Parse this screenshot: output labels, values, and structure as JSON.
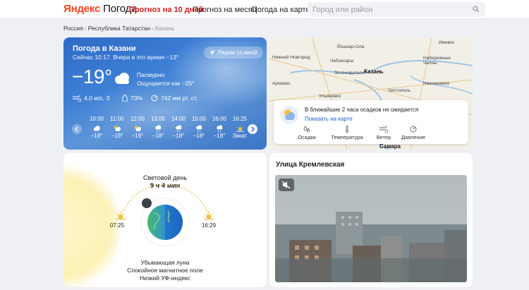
{
  "header": {
    "logo_brand": "Яндекс",
    "logo_product": "Погода",
    "nav": [
      "Прогноз на 10 дней",
      "Прогноз на месяц",
      "Погода на карте"
    ],
    "search_placeholder": "Город или район"
  },
  "breadcrumbs": [
    "Россия",
    "Республика Татарстан",
    "Казань"
  ],
  "current": {
    "title": "Погода в Казани",
    "subtitle": "Сейчас 10:17. Вчера в это время −13°",
    "near_button": "Рядом со мной",
    "temp": "−19°",
    "condition": "Пасмурно",
    "feels_like": "Ощущается как −25°",
    "wind": "4,0 м/с, З",
    "humidity": "73%",
    "pressure": "742 мм рт. ст."
  },
  "hourly": [
    {
      "time": "10:00",
      "temp": "−19°",
      "icon": "cloud-icon"
    },
    {
      "time": "11:00",
      "temp": "−19°",
      "icon": "sun-cloud-icon"
    },
    {
      "time": "12:00",
      "temp": "−19°",
      "icon": "sun-cloud-icon"
    },
    {
      "time": "13:00",
      "temp": "−18°",
      "icon": "snow-cloud-icon"
    },
    {
      "time": "14:00",
      "temp": "−18°",
      "icon": "snow-cloud-icon"
    },
    {
      "time": "15:00",
      "temp": "−18°",
      "icon": "snow-cloud-icon"
    },
    {
      "time": "16:00",
      "temp": "−18°",
      "icon": "snow-cloud-icon"
    },
    {
      "time": "16:25",
      "temp": "Закат",
      "icon": "sunset-icon"
    }
  ],
  "map": {
    "cities": [
      "Ижевск",
      "Нижний Новгород",
      "Йошкар-Ола",
      "Чебоксары",
      "Зеленодольск",
      "Казань",
      "Набережные Челны",
      "Нижнекамск",
      "Арзамас",
      "Чистополь",
      "Ульяновск",
      "Самара"
    ],
    "precip_message": "В ближайшие 2 часа осадков не ожидается",
    "precip_link": "Показать на карте",
    "layers": [
      "Осадки",
      "Температура",
      "Ветер",
      "Давление"
    ]
  },
  "daylight": {
    "title": "Световой день",
    "duration": "9 ч 4 мин",
    "sunrise": "07:25",
    "sunset": "16:29",
    "moon": "Убывающая луна",
    "magnetic": "Спокойное магнитное поле",
    "uv": "Низкий УФ-индекс"
  },
  "camera": {
    "title": "Улица Кремлевская"
  },
  "colors": {
    "accent_red": "#d41a1a",
    "logo_red": "#fc3f1d",
    "link_blue": "#1c63c6",
    "card_blue": "#3d7fd5"
  }
}
